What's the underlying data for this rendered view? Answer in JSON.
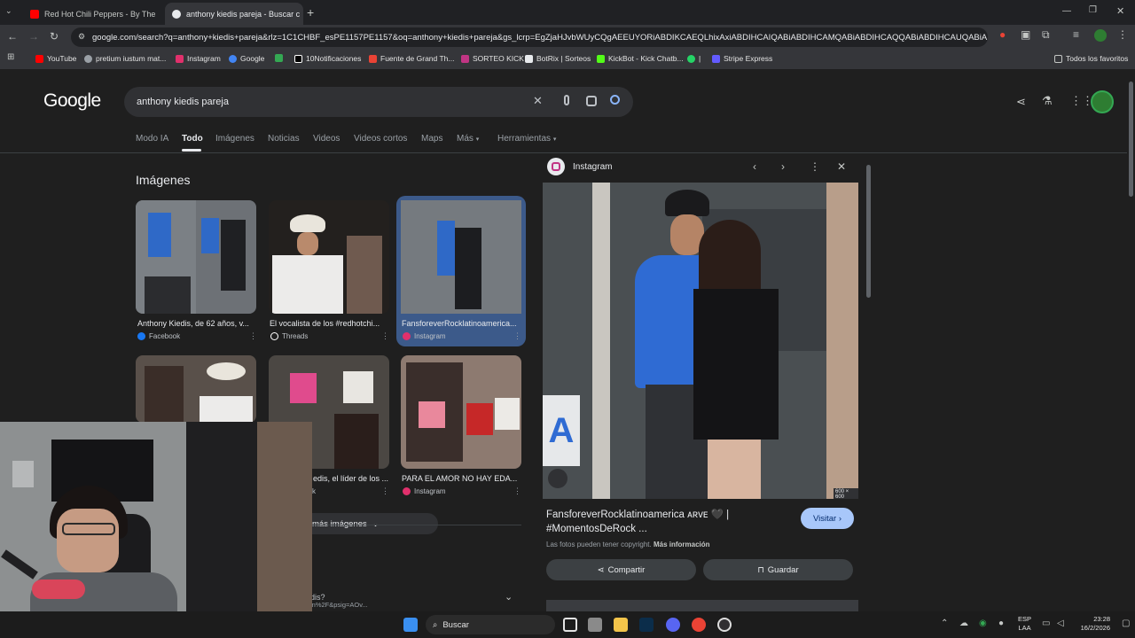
{
  "browser": {
    "tabs": [
      {
        "label": "Red Hot Chili Peppers - By The",
        "favicon_color": "#ff0000"
      },
      {
        "label": "anthony kiedis pareja - Buscar c",
        "favicon_color": "#4285f4"
      }
    ],
    "url": "google.com/search?q=anthony+kiedis+pareja&rlz=1C1CHBF_esPE1157PE1157&oq=anthony+kiedis+pareja&gs_lcrp=EgZjaHJvbWUyCQgAEEUYORiABDIKCAEQLhixAxiABDIHCAIQABiABDIHCAMQABiABDIHCAQQABiABDIHCAUQABiABDIHCAYQABiABDIHCAcQABiABDIHCAgQABiABDIHCAkQABiABNIBCDQ3MjNqMGo3qAIAsAIA&sourceid=chrome&ie=UTF-8",
    "bookmarks": [
      {
        "label": "YouTube",
        "color": "#ff0000"
      },
      {
        "label": "pretium iustum mat...",
        "color": "#9aa0a6"
      },
      {
        "label": "Instagram",
        "color": "#e1306c"
      },
      {
        "label": "Google",
        "color": "#4285f4"
      },
      {
        "label": "",
        "color": "#34a853"
      },
      {
        "label": "10Notificaciones",
        "color": "#ffffff"
      },
      {
        "label": "Fuente de Grand Th...",
        "color": "#ea4335"
      },
      {
        "label": "SORTEO KICK",
        "color": "#c13584"
      },
      {
        "label": "BotRix | Sorteos",
        "color": "#e8eaed"
      },
      {
        "label": "KickBot - Kick Chatb...",
        "color": "#53fc18"
      },
      {
        "label": "|",
        "color": "#25d366"
      },
      {
        "label": "Stripe Express",
        "color": "#635bff"
      }
    ],
    "bookmarks_folder": "Todos los favoritos"
  },
  "google": {
    "logo": "Google",
    "query": "anthony kiedis pareja",
    "nav_tabs": [
      "Modo IA",
      "Todo",
      "Imágenes",
      "Noticias",
      "Videos",
      "Videos cortos",
      "Maps",
      "Más",
      "Herramientas"
    ],
    "active_tab": "Todo",
    "images_heading": "Imágenes",
    "results": [
      {
        "caption": "Anthony Kiedis, de 62 años, v...",
        "source": "Facebook",
        "source_color": "#1877f2"
      },
      {
        "caption": "El vocalista de los #redhotchi...",
        "source": "Threads",
        "source_color": "#ffffff"
      },
      {
        "caption": "FansforeverRocklatinoamerica...",
        "source": "Instagram",
        "source_color": "#e1306c"
      },
      {
        "caption": "edis, el líder de los ...",
        "source": "k",
        "source_color": "#1877f2"
      },
      {
        "caption": "PARA EL AMOR NO HAY EDA...",
        "source": "Instagram",
        "source_color": "#e1306c"
      }
    ],
    "more_images": "más imágenes",
    "partial_text_1": "dis?",
    "partial_text_2": "in%2F&psig=AOv..."
  },
  "preview": {
    "source": "Instagram",
    "image_size": "600 × 600",
    "title": "FansforeverRocklatinoamerica ᴀʀᴠᴇ 🖤 | #MomentosDeRock ...",
    "copyright": "Las fotos pueden tener copyright.",
    "more_info": "Más información",
    "visit": "Visitar",
    "share": "Compartir",
    "save": "Guardar"
  },
  "taskbar": {
    "search": "Buscar",
    "lang_1": "ESP",
    "lang_2": "LAA",
    "time": "23:28",
    "date": "16/2/2026"
  }
}
